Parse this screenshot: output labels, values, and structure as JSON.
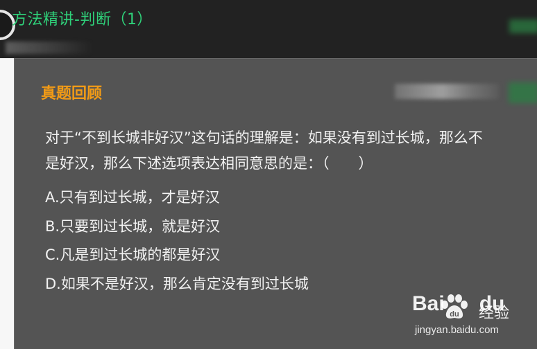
{
  "header": {
    "title": "方法精讲-判断（1）"
  },
  "slide": {
    "section_title": "真题回顾",
    "question_lines": [
      "对于“不到长城非好汉”这句话的理解是：如果没有到过长城，那么不",
      "是好汉，那么下述选项表达相同意思的是：（　　）"
    ],
    "options": [
      "A.只有到过长城，才是好汉",
      "B.只要到过长城，就是好汉",
      "C.凡是到过长城的都是好汉",
      "D.如果不是好汉，那么肯定没有到过长城"
    ]
  },
  "watermark": {
    "brand_left": "Bai",
    "brand_right": "du",
    "product": "经验",
    "url": "jingyan.baidu.com"
  },
  "colors": {
    "header_title": "#2fd17a",
    "section_title": "#f29b16",
    "slide_bg": "#545454",
    "topbar_bg": "#222222"
  }
}
